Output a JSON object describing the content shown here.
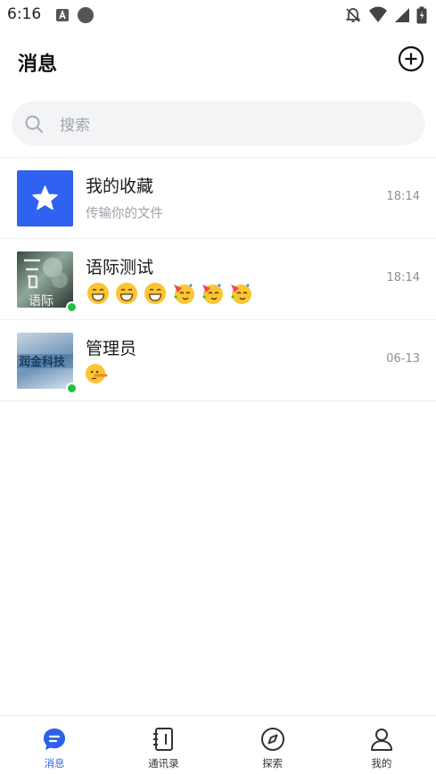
{
  "status_bar": {
    "time": "6:16",
    "icons": [
      "a-notification-icon",
      "circle-notification-icon",
      "bell-off-icon",
      "wifi-icon",
      "signal-icon",
      "battery-icon"
    ]
  },
  "header": {
    "title": "消息",
    "add_icon": "plus-circle-icon"
  },
  "search": {
    "placeholder": "搜索",
    "icon": "search-icon"
  },
  "chats": [
    {
      "name": "我的收藏",
      "preview": "传输你的文件",
      "time": "18:14",
      "avatar": "star-icon",
      "online": false
    },
    {
      "name": "语际测试",
      "preview_emojis": [
        "grin",
        "grin",
        "grin",
        "party",
        "party",
        "party"
      ],
      "time": "18:14",
      "avatar_text": "语际",
      "online": true
    },
    {
      "name": "管理员",
      "preview_emojis": [
        "lying-face"
      ],
      "time": "06-13",
      "avatar_text": "润金科技",
      "online": true
    }
  ],
  "bottom_nav": [
    {
      "label": "消息",
      "icon": "chat-bubble-icon",
      "active": true
    },
    {
      "label": "通讯录",
      "icon": "contacts-book-icon",
      "active": false
    },
    {
      "label": "探索",
      "icon": "compass-icon",
      "active": false
    },
    {
      "label": "我的",
      "icon": "person-icon",
      "active": false
    }
  ],
  "colors": {
    "accent": "#2c61e8",
    "online": "#22c03c",
    "search_bg": "#f3f4f6",
    "muted_text": "#9ea2a8"
  }
}
